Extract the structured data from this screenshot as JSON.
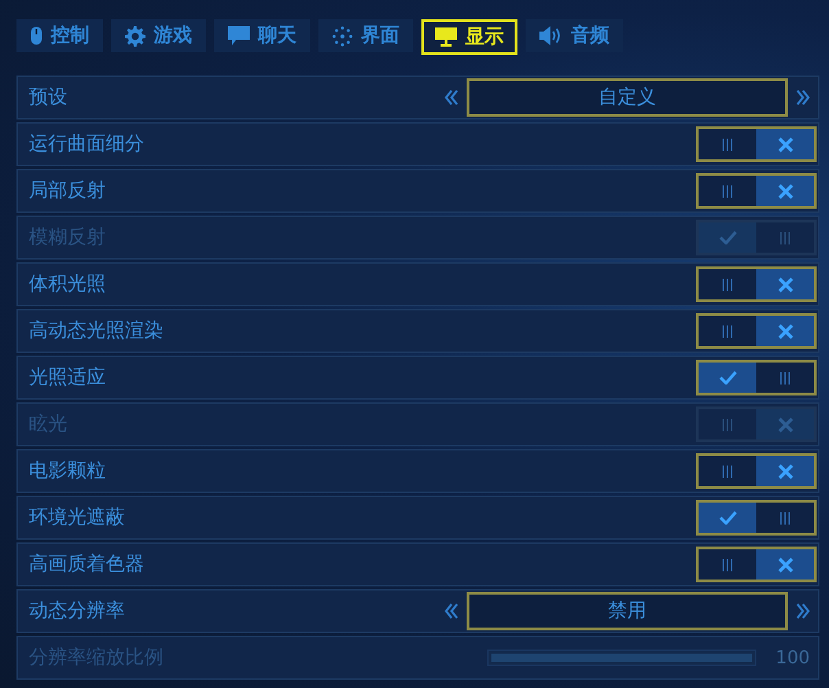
{
  "tabs": [
    {
      "label": "控制",
      "kind": "mouse",
      "selected": false
    },
    {
      "label": "游戏",
      "kind": "gear",
      "selected": false
    },
    {
      "label": "聊天",
      "kind": "chat",
      "selected": false
    },
    {
      "label": "界面",
      "kind": "dots",
      "selected": false
    },
    {
      "label": "显示",
      "kind": "monitor",
      "selected": true
    },
    {
      "label": "音频",
      "kind": "speaker",
      "selected": false
    }
  ],
  "settings": [
    {
      "kind": "selector",
      "label": "预设",
      "value": "自定义",
      "disabled": false
    },
    {
      "kind": "toggle",
      "label": "运行曲面细分",
      "on": false,
      "disabled": false
    },
    {
      "kind": "toggle",
      "label": "局部反射",
      "on": false,
      "disabled": false
    },
    {
      "kind": "toggle",
      "label": "模糊反射",
      "on": true,
      "disabled": true
    },
    {
      "kind": "toggle",
      "label": "体积光照",
      "on": false,
      "disabled": false
    },
    {
      "kind": "toggle",
      "label": "高动态光照渲染",
      "on": false,
      "disabled": false
    },
    {
      "kind": "toggle",
      "label": "光照适应",
      "on": true,
      "disabled": false
    },
    {
      "kind": "toggle",
      "label": "眩光",
      "on": false,
      "disabled": true
    },
    {
      "kind": "toggle",
      "label": "电影颗粒",
      "on": false,
      "disabled": false
    },
    {
      "kind": "toggle",
      "label": "环境光遮蔽",
      "on": true,
      "disabled": false
    },
    {
      "kind": "toggle",
      "label": "高画质着色器",
      "on": false,
      "disabled": false
    },
    {
      "kind": "selector",
      "label": "动态分辨率",
      "value": "禁用",
      "disabled": false
    },
    {
      "kind": "slider",
      "label": "分辨率缩放比例",
      "level": 1,
      "reading": "100",
      "disabled": true
    }
  ]
}
